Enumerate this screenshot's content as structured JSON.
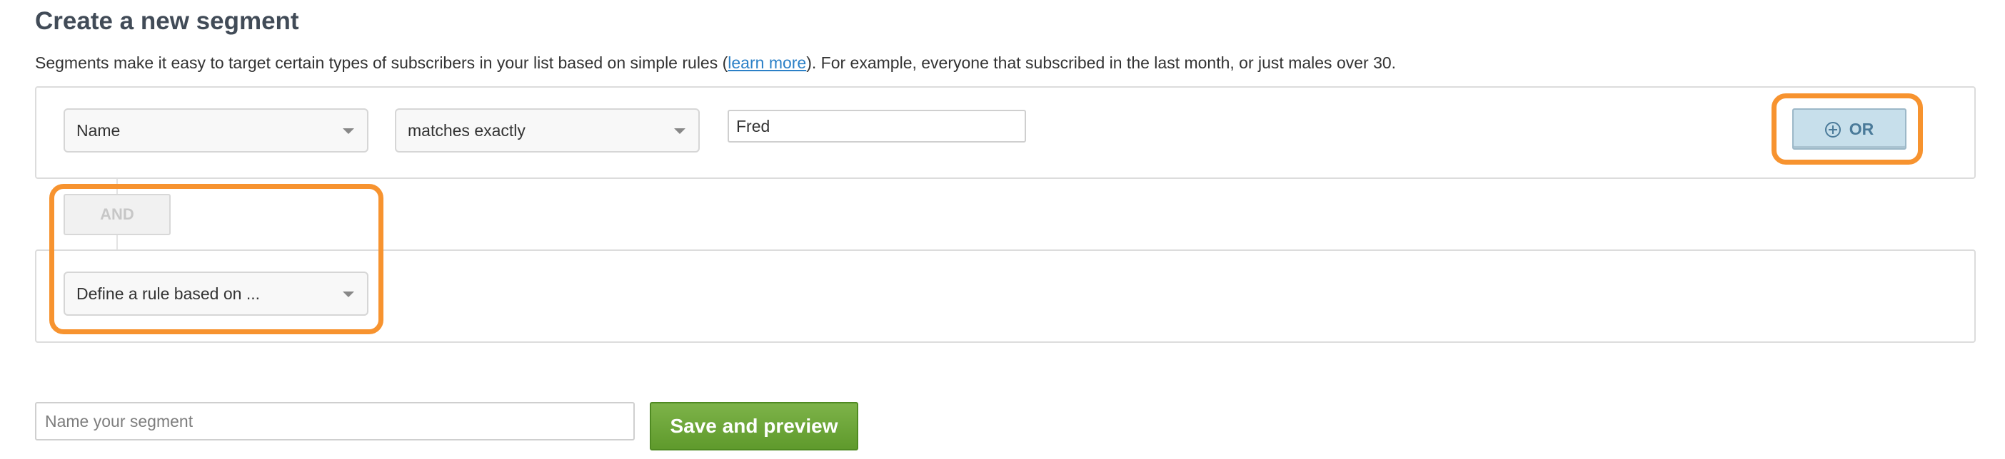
{
  "page": {
    "title": "Create a new segment",
    "intro_before": "Segments make it easy to target certain types of subscribers in your list based on simple rules (",
    "intro_link": "learn more",
    "intro_after": "). For example, everyone that subscribed in the last month, or just males over 30."
  },
  "rule_group_1": {
    "field_select": "Name",
    "operator_select": "matches exactly",
    "value_input": "Fred",
    "or_button_label": "OR",
    "or_icon": "plus-circle-icon"
  },
  "and_button_label": "AND",
  "rule_group_2": {
    "field_select": "Define a rule based on ..."
  },
  "footer": {
    "segment_name_placeholder": "Name your segment",
    "save_button_label": "Save and preview"
  },
  "colors": {
    "highlight": "#f7932f",
    "save_button": "#6aa334",
    "or_button": "#c7dfeb",
    "link": "#2b80c7"
  }
}
